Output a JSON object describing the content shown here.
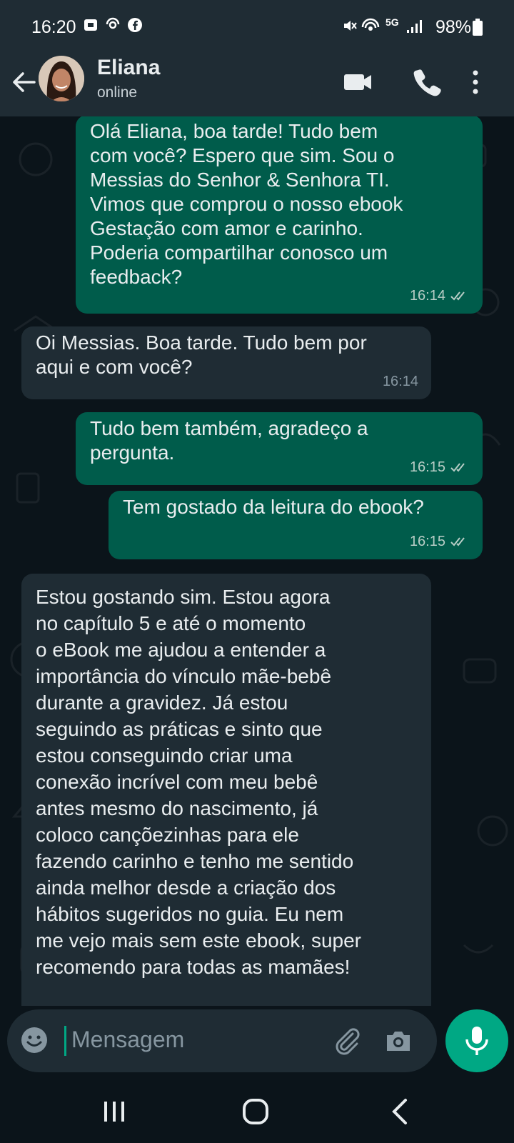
{
  "status_bar": {
    "time": "16:20",
    "network": "5G",
    "battery": "98%"
  },
  "header": {
    "contact_name": "Eliana",
    "contact_status": "online"
  },
  "messages": [
    {
      "direction": "outgoing",
      "text": "Olá Eliana, boa tarde! Tudo bem\ncom você? Espero que sim. Sou o\nMessias do Senhor & Senhora TI.\nVimos que comprou o nosso ebook\nGestação com amor e carinho.\nPoderia compartilhar conosco um\nfeedback?",
      "time": "16:14",
      "status": "read"
    },
    {
      "direction": "incoming",
      "text": "Oi Messias. Boa tarde. Tudo bem por\naqui e com você?",
      "time": "16:14"
    },
    {
      "direction": "outgoing",
      "text": "Tudo bem também, agradeço a\npergunta.",
      "time": "16:15",
      "status": "read"
    },
    {
      "direction": "outgoing",
      "text": "Tem gostado da leitura do ebook?",
      "time": "16:15",
      "status": "read"
    },
    {
      "direction": "incoming",
      "text": "Estou gostando sim. Estou agora\nno capítulo 5 e até o momento\no eBook me ajudou a entender a\nimportância do vínculo mãe-bebê\ndurante a gravidez. Já estou\nseguindo as práticas e sinto que\nestou conseguindo criar uma\nconexão incrível com meu bebê\nantes mesmo do nascimento, já\ncoloco cançõezinhas para ele\nfazendo carinho e tenho me sentido\nainda melhor desde a criação dos\nhábitos sugeridos no guia. Eu nem\nme vejo mais sem este ebook, super\nrecomendo para todas as mamães!",
      "time": ""
    }
  ],
  "input": {
    "placeholder": "Mensagem"
  },
  "colors": {
    "outgoing_bubble": "#005c4b",
    "incoming_bubble": "#1f2c34",
    "accent": "#00a884",
    "read_ticks": "#b8cdc6"
  },
  "icons": [
    "back-arrow-icon",
    "video-call-icon",
    "phone-icon",
    "more-options-icon",
    "emoji-icon",
    "attach-icon",
    "camera-icon",
    "mic-icon",
    "recent-apps-icon",
    "home-icon",
    "nav-back-icon"
  ]
}
